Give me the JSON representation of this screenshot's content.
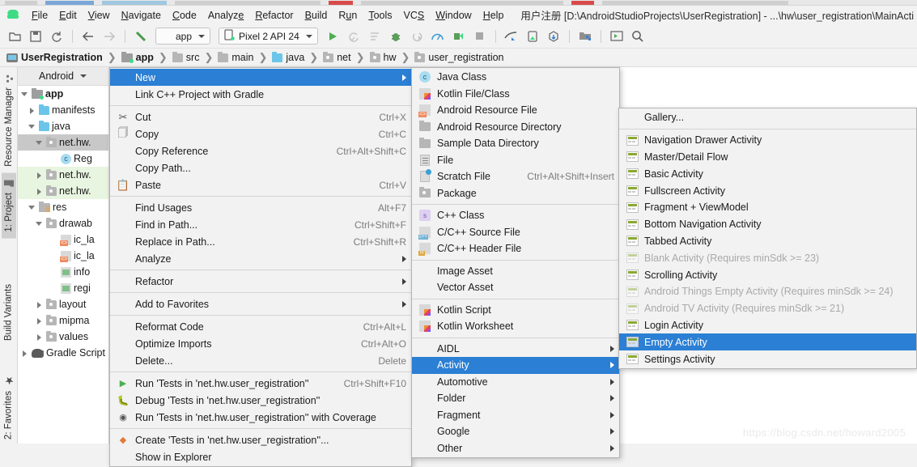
{
  "window": {
    "title": "用户注册 [D:\\AndroidStudioProjects\\UserRegistration] - ...\\hw\\user_registration\\MainActi"
  },
  "menubar": {
    "logo_icon": "android-logo-icon",
    "items": [
      {
        "label": "File"
      },
      {
        "label": "Edit"
      },
      {
        "label": "View"
      },
      {
        "label": "Navigate"
      },
      {
        "label": "Code"
      },
      {
        "label": "Analyze"
      },
      {
        "label": "Refactor"
      },
      {
        "label": "Build"
      },
      {
        "label": "Run"
      },
      {
        "label": "Tools"
      },
      {
        "label": "VCS"
      },
      {
        "label": "Window"
      },
      {
        "label": "Help"
      }
    ]
  },
  "toolbar": {
    "module_selector": "app",
    "device_selector": "Pixel 2 API 24",
    "buttons": [
      "open-folder-icon",
      "save-all-icon",
      "sync-project-icon",
      "back-icon",
      "forward-icon",
      "build-hammer-icon",
      "run-icon",
      "rerun-icon",
      "stop-alt-icon",
      "debug-icon",
      "run-coverage-icon",
      "profiler-icon",
      "apply-changes-icon",
      "stop-icon",
      "sdk-manager-icon",
      "avd-manager-icon",
      "gradle-sync-icon",
      "project-structure-icon",
      "layout-inspector-icon",
      "search-everywhere-icon"
    ]
  },
  "breadcrumb": {
    "items": [
      {
        "label": "UserRegistration",
        "icon": "project-icon"
      },
      {
        "label": "app",
        "icon": "module-icon"
      },
      {
        "label": "src",
        "icon": "folder-icon"
      },
      {
        "label": "main",
        "icon": "folder-icon"
      },
      {
        "label": "java",
        "icon": "folder-blue-icon"
      },
      {
        "label": "net",
        "icon": "package-icon"
      },
      {
        "label": "hw",
        "icon": "package-icon"
      },
      {
        "label": "user_registration",
        "icon": "package-icon"
      }
    ]
  },
  "left_strip": {
    "tabs": [
      {
        "label": "Resource Manager",
        "icon": "resource-manager-icon",
        "active": false
      },
      {
        "label": "1: Project",
        "icon": "project-folder-icon",
        "active": true
      },
      {
        "label": "Build Variants",
        "icon": "build-variants-icon",
        "active": false
      },
      {
        "label": "2: Favorites",
        "icon": "star-icon",
        "active": false
      }
    ]
  },
  "project_pane": {
    "header": "Android",
    "header_icon": "android-icon",
    "tree": [
      {
        "label": "app",
        "indent": 0,
        "arrow": "open",
        "icon": "module-icon",
        "bold": true,
        "state": "normal"
      },
      {
        "label": "manifests",
        "indent": 1,
        "arrow": "closed",
        "icon": "folder-blue-icon",
        "bold": false,
        "state": "normal"
      },
      {
        "label": "java",
        "indent": 1,
        "arrow": "open",
        "icon": "folder-blue-icon",
        "bold": false,
        "state": "normal"
      },
      {
        "label": "net.hw.",
        "indent": 2,
        "arrow": "open",
        "icon": "package-icon",
        "bold": false,
        "state": "selected"
      },
      {
        "label": "Reg",
        "indent": 4,
        "arrow": "none",
        "icon": "class-icon",
        "bold": false,
        "state": "normal"
      },
      {
        "label": "net.hw.",
        "indent": 2,
        "arrow": "closed",
        "icon": "package-icon",
        "bold": false,
        "state": "green"
      },
      {
        "label": "net.hw.",
        "indent": 2,
        "arrow": "closed",
        "icon": "package-icon",
        "bold": false,
        "state": "green"
      },
      {
        "label": "res",
        "indent": 1,
        "arrow": "open",
        "icon": "res-icon",
        "bold": false,
        "state": "normal"
      },
      {
        "label": "drawab",
        "indent": 2,
        "arrow": "open",
        "icon": "package-icon",
        "bold": false,
        "state": "normal"
      },
      {
        "label": "ic_la",
        "indent": 4,
        "arrow": "none",
        "icon": "xml-icon",
        "bold": false,
        "state": "normal"
      },
      {
        "label": "ic_la",
        "indent": 4,
        "arrow": "none",
        "icon": "xml-icon",
        "bold": false,
        "state": "normal"
      },
      {
        "label": "info",
        "indent": 4,
        "arrow": "none",
        "icon": "image-icon",
        "bold": false,
        "state": "normal"
      },
      {
        "label": "regi",
        "indent": 4,
        "arrow": "none",
        "icon": "image-icon",
        "bold": false,
        "state": "normal"
      },
      {
        "label": "layout",
        "indent": 2,
        "arrow": "closed",
        "icon": "package-icon",
        "bold": false,
        "state": "normal"
      },
      {
        "label": "mipma",
        "indent": 2,
        "arrow": "closed",
        "icon": "package-icon",
        "bold": false,
        "state": "normal"
      },
      {
        "label": "values",
        "indent": 2,
        "arrow": "closed",
        "icon": "package-icon",
        "bold": false,
        "state": "normal"
      },
      {
        "label": "Gradle Script",
        "indent": 0,
        "arrow": "closed",
        "icon": "gradle-icon",
        "bold": false,
        "state": "normal"
      }
    ]
  },
  "context_menu": {
    "items": [
      {
        "label": "New",
        "accel": "",
        "icon": "",
        "submenu": true,
        "highlight": true
      },
      {
        "label": "Link C++ Project with Gradle",
        "accel": "",
        "icon": "",
        "submenu": false,
        "sep_after": true
      },
      {
        "label": "Cut",
        "accel": "Ctrl+X",
        "icon": "cut-icon",
        "submenu": false
      },
      {
        "label": "Copy",
        "accel": "Ctrl+C",
        "icon": "copy-icon",
        "submenu": false
      },
      {
        "label": "Copy Reference",
        "accel": "Ctrl+Alt+Shift+C",
        "icon": "",
        "submenu": false
      },
      {
        "label": "Copy Path...",
        "accel": "",
        "icon": "",
        "submenu": false
      },
      {
        "label": "Paste",
        "accel": "Ctrl+V",
        "icon": "paste-icon",
        "submenu": false,
        "sep_after": true
      },
      {
        "label": "Find Usages",
        "accel": "Alt+F7",
        "icon": "",
        "submenu": false
      },
      {
        "label": "Find in Path...",
        "accel": "Ctrl+Shift+F",
        "icon": "",
        "submenu": false
      },
      {
        "label": "Replace in Path...",
        "accel": "Ctrl+Shift+R",
        "icon": "",
        "submenu": false
      },
      {
        "label": "Analyze",
        "accel": "",
        "icon": "",
        "submenu": true,
        "sep_after": true
      },
      {
        "label": "Refactor",
        "accel": "",
        "icon": "",
        "submenu": true,
        "sep_after": true
      },
      {
        "label": "Add to Favorites",
        "accel": "",
        "icon": "",
        "submenu": true,
        "sep_after": true
      },
      {
        "label": "Reformat Code",
        "accel": "Ctrl+Alt+L",
        "icon": "",
        "submenu": false
      },
      {
        "label": "Optimize Imports",
        "accel": "Ctrl+Alt+O",
        "icon": "",
        "submenu": false
      },
      {
        "label": "Delete...",
        "accel": "Delete",
        "icon": "",
        "submenu": false,
        "sep_after": true
      },
      {
        "label": "Run 'Tests in 'net.hw.user_registration''",
        "accel": "Ctrl+Shift+F10",
        "icon": "run-icon",
        "submenu": false
      },
      {
        "label": "Debug 'Tests in 'net.hw.user_registration''",
        "accel": "",
        "icon": "debug-icon",
        "submenu": false
      },
      {
        "label": "Run 'Tests in 'net.hw.user_registration'' with Coverage",
        "accel": "",
        "icon": "coverage-icon",
        "submenu": false,
        "sep_after": true
      },
      {
        "label": "Create 'Tests in 'net.hw.user_registration''...",
        "accel": "",
        "icon": "create-config-icon",
        "submenu": false
      },
      {
        "label": "Show in Explorer",
        "accel": "",
        "icon": "",
        "submenu": false
      }
    ]
  },
  "new_menu": {
    "items": [
      {
        "label": "Java Class",
        "accel": "",
        "icon": "java-class-icon",
        "submenu": false
      },
      {
        "label": "Kotlin File/Class",
        "accel": "",
        "icon": "kotlin-file-icon",
        "submenu": false
      },
      {
        "label": "Android Resource File",
        "accel": "",
        "icon": "android-resource-file-icon",
        "submenu": false
      },
      {
        "label": "Android Resource Directory",
        "accel": "",
        "icon": "directory-icon",
        "submenu": false
      },
      {
        "label": "Sample Data Directory",
        "accel": "",
        "icon": "directory-icon",
        "submenu": false
      },
      {
        "label": "File",
        "accel": "",
        "icon": "file-icon",
        "submenu": false
      },
      {
        "label": "Scratch File",
        "accel": "Ctrl+Alt+Shift+Insert",
        "icon": "scratch-file-icon",
        "submenu": false
      },
      {
        "label": "Package",
        "accel": "",
        "icon": "package-icon",
        "submenu": false,
        "sep_after": true
      },
      {
        "label": "C++ Class",
        "accel": "",
        "icon": "cpp-class-icon",
        "submenu": false
      },
      {
        "label": "C/C++ Source File",
        "accel": "",
        "icon": "cpp-source-icon",
        "submenu": false
      },
      {
        "label": "C/C++ Header File",
        "accel": "",
        "icon": "cpp-header-icon",
        "submenu": false,
        "sep_after": true
      },
      {
        "label": "Image Asset",
        "accel": "",
        "icon": "android-icon",
        "submenu": false
      },
      {
        "label": "Vector Asset",
        "accel": "",
        "icon": "android-icon",
        "submenu": false,
        "sep_after": true
      },
      {
        "label": "Kotlin Script",
        "accel": "",
        "icon": "kotlin-file-icon",
        "submenu": false
      },
      {
        "label": "Kotlin Worksheet",
        "accel": "",
        "icon": "kotlin-file-icon",
        "submenu": false,
        "sep_after": true
      },
      {
        "label": "AIDL",
        "accel": "",
        "icon": "android-icon",
        "submenu": true
      },
      {
        "label": "Activity",
        "accel": "",
        "icon": "android-icon",
        "submenu": true,
        "highlight": true
      },
      {
        "label": "Automotive",
        "accel": "",
        "icon": "android-icon",
        "submenu": true
      },
      {
        "label": "Folder",
        "accel": "",
        "icon": "android-icon",
        "submenu": true
      },
      {
        "label": "Fragment",
        "accel": "",
        "icon": "android-icon",
        "submenu": true
      },
      {
        "label": "Google",
        "accel": "",
        "icon": "android-icon",
        "submenu": true
      },
      {
        "label": "Other",
        "accel": "",
        "icon": "android-icon",
        "submenu": true
      }
    ]
  },
  "activity_menu": {
    "items": [
      {
        "label": "Gallery...",
        "icon": "android-icon",
        "disabled": false,
        "highlight": false,
        "sep_after": true
      },
      {
        "label": "Navigation Drawer Activity",
        "icon": "template-icon",
        "disabled": false,
        "highlight": false
      },
      {
        "label": "Master/Detail Flow",
        "icon": "template-icon",
        "disabled": false,
        "highlight": false
      },
      {
        "label": "Basic Activity",
        "icon": "template-icon",
        "disabled": false,
        "highlight": false
      },
      {
        "label": "Fullscreen Activity",
        "icon": "template-icon",
        "disabled": false,
        "highlight": false
      },
      {
        "label": "Fragment + ViewModel",
        "icon": "template-icon",
        "disabled": false,
        "highlight": false
      },
      {
        "label": "Bottom Navigation Activity",
        "icon": "template-icon",
        "disabled": false,
        "highlight": false
      },
      {
        "label": "Tabbed Activity",
        "icon": "template-icon",
        "disabled": false,
        "highlight": false
      },
      {
        "label": "Blank Activity (Requires minSdk >= 23)",
        "icon": "template-icon",
        "disabled": true,
        "highlight": false
      },
      {
        "label": "Scrolling Activity",
        "icon": "template-icon",
        "disabled": false,
        "highlight": false
      },
      {
        "label": "Android Things Empty Activity (Requires minSdk >= 24)",
        "icon": "template-icon",
        "disabled": true,
        "highlight": false
      },
      {
        "label": "Android TV Activity (Requires minSdk >= 21)",
        "icon": "template-icon",
        "disabled": true,
        "highlight": false
      },
      {
        "label": "Login Activity",
        "icon": "template-icon",
        "disabled": false,
        "highlight": false
      },
      {
        "label": "Empty Activity",
        "icon": "template-icon",
        "disabled": false,
        "highlight": true
      },
      {
        "label": "Settings Activity",
        "icon": "template-icon",
        "disabled": false,
        "highlight": false
      }
    ]
  },
  "watermark": {
    "text": "https://blog.csdn.net/howard2005"
  },
  "colors": {
    "highlight": "#2b7fd4",
    "android_green": "#3ddc84",
    "menu_bg": "#f2f2f2",
    "tree_selected": "#c8c8c8",
    "tree_green": "#e8f5e0"
  }
}
